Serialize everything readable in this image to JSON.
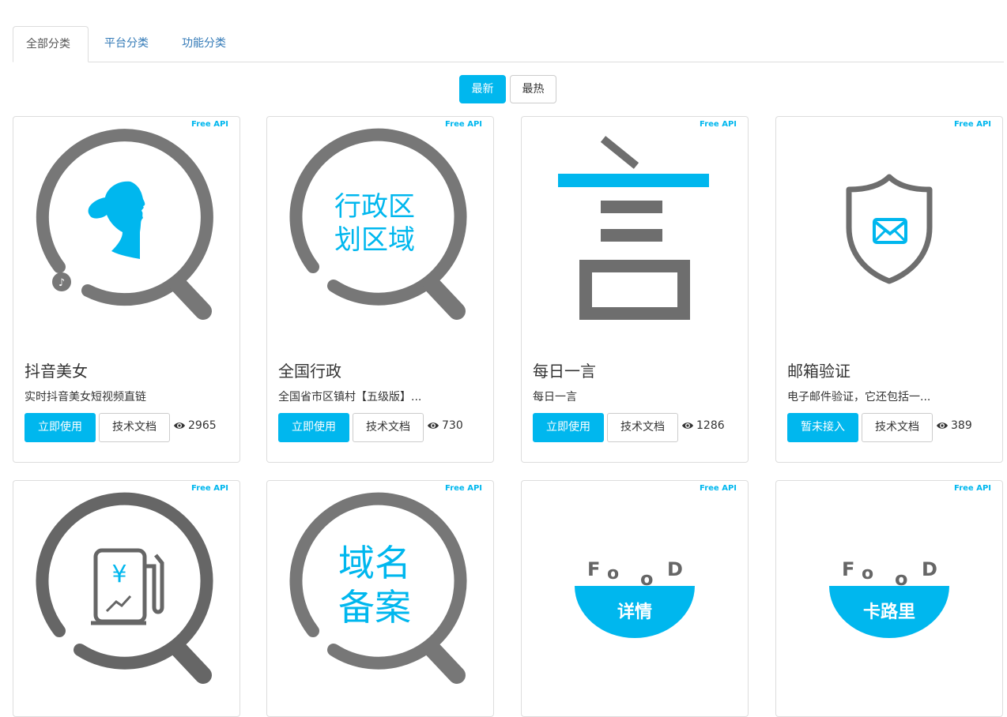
{
  "tabs": [
    {
      "label": "全部分类",
      "active": true
    },
    {
      "label": "平台分类",
      "active": false
    },
    {
      "label": "功能分类",
      "active": false
    }
  ],
  "sort": {
    "newest": "最新",
    "hottest": "最热"
  },
  "colors": {
    "accent": "#00b7ee",
    "icon_gray": "#6e6e6e"
  },
  "cards": [
    {
      "badge": "Free API",
      "title": "抖音美女",
      "desc": "实时抖音美女短视频直链",
      "action": "立即使用",
      "doc": "技术文档",
      "views": "2965",
      "icon": "douyin-beauty-icon"
    },
    {
      "badge": "Free API",
      "title": "全国行政",
      "desc": "全国省市区镇村【五级版】...",
      "action": "立即使用",
      "doc": "技术文档",
      "views": "730",
      "icon": "region-search-icon",
      "icon_text": [
        "行政区",
        "划区域"
      ]
    },
    {
      "badge": "Free API",
      "title": "每日一言",
      "desc": "每日一言",
      "action": "立即使用",
      "doc": "技术文档",
      "views": "1286",
      "icon": "yan-character-icon"
    },
    {
      "badge": "Free API",
      "title": "邮箱验证",
      "desc": "电子邮件验证，它还包括一...",
      "action": "暂未接入",
      "doc": "技术文档",
      "views": "389",
      "icon": "mail-shield-icon"
    },
    {
      "badge": "Free API",
      "icon": "fuel-price-icon",
      "icon_text": [
        "¥"
      ]
    },
    {
      "badge": "Free API",
      "icon": "domain-record-icon",
      "icon_text": [
        "域名",
        "备案"
      ]
    },
    {
      "badge": "Free API",
      "icon": "food-detail-icon",
      "icon_text": [
        "F",
        "o",
        "o",
        "D",
        "详情"
      ]
    },
    {
      "badge": "Free API",
      "icon": "food-calorie-icon",
      "icon_text": [
        "F",
        "o",
        "o",
        "D",
        "卡路里"
      ]
    }
  ]
}
